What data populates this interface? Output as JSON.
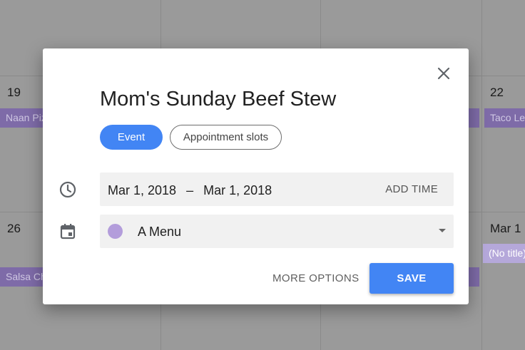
{
  "calendar": {
    "day_numbers": [
      "19",
      "22",
      "26",
      "Mar 1"
    ],
    "events": [
      "Naan Pizza",
      "Taco Lettuce Wraps",
      "Salsa Chicken",
      "(No title)"
    ]
  },
  "dialog": {
    "title": "Mom's Sunday Beef Stew",
    "tabs": [
      "Event",
      "Appointment slots"
    ],
    "start_date": "Mar 1, 2018",
    "date_separator": "–",
    "end_date": "Mar 1, 2018",
    "add_time_label": "ADD TIME",
    "calendar_name": "A Menu",
    "calendar_color": "#b39ddb",
    "more_options_label": "MORE OPTIONS",
    "save_label": "SAVE"
  },
  "colors": {
    "accent": "#4285f4",
    "event_chip": "#7e6ba8",
    "scrim": "#9a9a9a"
  },
  "icons": {
    "close": "close-icon",
    "time": "clock-icon",
    "calendar": "calendar-icon",
    "dropdown": "dropdown-arrow-icon"
  }
}
